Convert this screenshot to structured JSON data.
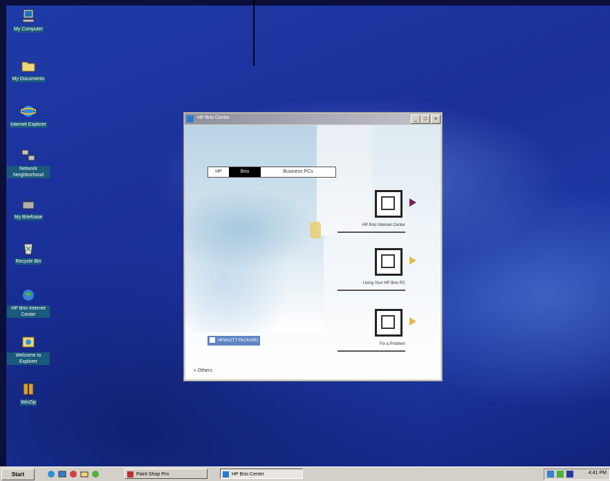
{
  "desktop": {
    "icons": [
      {
        "label": "My Computer",
        "icon": "computer-icon"
      },
      {
        "label": "My Documents",
        "icon": "folder-icon"
      },
      {
        "label": "Internet Explorer",
        "icon": "ie-icon"
      },
      {
        "label": "Network Neighborhood",
        "icon": "network-icon"
      },
      {
        "label": "My Briefcase",
        "icon": "briefcase-icon"
      },
      {
        "label": "Recycle Bin",
        "icon": "recycle-bin-icon"
      },
      {
        "label": "HP Brio Internet Center",
        "icon": "hp-globe-icon"
      },
      {
        "label": "Welcome to Explorer",
        "icon": "explorer-icon"
      },
      {
        "label": "WinZip",
        "icon": "winzip-icon"
      }
    ]
  },
  "window": {
    "title": "HP Brio Center",
    "buttons": {
      "minimize": "_",
      "maximize": "□",
      "close": "×"
    },
    "tabs": [
      "HP",
      "Brio",
      "Business PCs"
    ],
    "active_tab": "Brio",
    "items": [
      {
        "label": "HP Brio Internet Center",
        "icon": "monitor-icon",
        "arrow_color": "#7a1d5c"
      },
      {
        "label": "Using Your HP Brio PC",
        "icon": "book-icon",
        "arrow_color": "#e6b84a"
      },
      {
        "label": "Fix a Problem",
        "icon": "tools-icon",
        "arrow_color": "#e6b84a"
      }
    ],
    "logo_text": "HEWLETT PACKARD",
    "about_link": "« Others"
  },
  "taskbar": {
    "start_label": "Start",
    "tasks": [
      {
        "label": "Paint Shop Pro",
        "active": false
      },
      {
        "label": "HP Brio Center",
        "active": true
      }
    ],
    "clock": "4:41 PM"
  }
}
